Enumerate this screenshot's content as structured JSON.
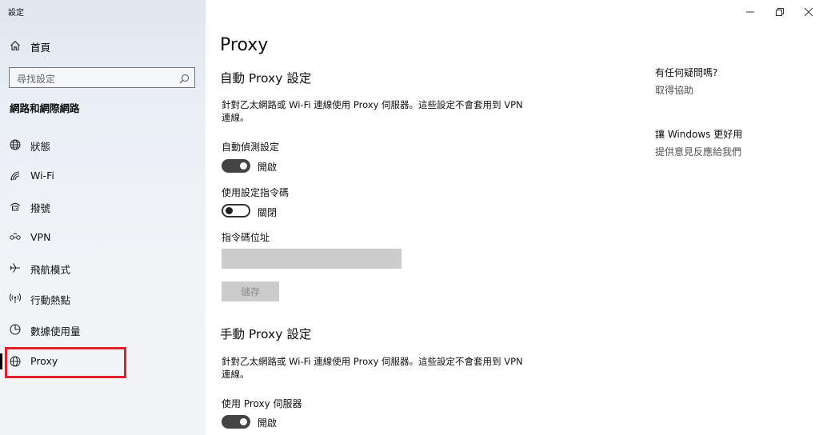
{
  "window": {
    "title": "設定",
    "minimize_icon": "minimize-icon",
    "restore_icon": "restore-icon",
    "close_icon": "close-icon"
  },
  "sidebar": {
    "home_label": "首頁",
    "search_placeholder": "尋找設定",
    "section_title": "網路和網際網路",
    "items": [
      {
        "label": "狀態",
        "icon": "globe-status-icon"
      },
      {
        "label": "Wi-Fi",
        "icon": "wifi-icon"
      },
      {
        "label": "撥號",
        "icon": "dialup-icon"
      },
      {
        "label": "VPN",
        "icon": "vpn-icon"
      },
      {
        "label": "飛航模式",
        "icon": "airplane-icon"
      },
      {
        "label": "行動熱點",
        "icon": "hotspot-icon"
      },
      {
        "label": "數據使用量",
        "icon": "data-usage-icon"
      },
      {
        "label": "Proxy",
        "icon": "globe-icon",
        "selected": true
      }
    ],
    "highlight_color": "#e0202a"
  },
  "main": {
    "title": "Proxy",
    "auto": {
      "heading": "自動 Proxy 設定",
      "description": "針對乙太網路或 Wi-Fi 連線使用 Proxy 伺服器。這些設定不會套用到 VPN 連線。",
      "detect_label": "自動偵測設定",
      "detect_state": "開啟",
      "detect_on": true,
      "script_label": "使用設定指令碼",
      "script_state": "關閉",
      "script_on": false,
      "address_label": "指令碼位址",
      "address_value": "",
      "save_label": "儲存"
    },
    "manual": {
      "heading": "手動 Proxy 設定",
      "description": "針對乙太網路或 Wi-Fi 連線使用 Proxy 伺服器。這些設定不會套用到 VPN 連線。",
      "use_proxy_label": "使用 Proxy 伺服器",
      "use_proxy_state": "開啟",
      "use_proxy_on": true
    }
  },
  "help": {
    "question": "有任何疑問嗎?",
    "get_help": "取得協助",
    "feedback_title": "讓 Windows 更好用",
    "feedback_link": "提供意見反應給我們"
  },
  "colors": {
    "toggle_on": "#444444",
    "accent_bar": "#000000"
  }
}
